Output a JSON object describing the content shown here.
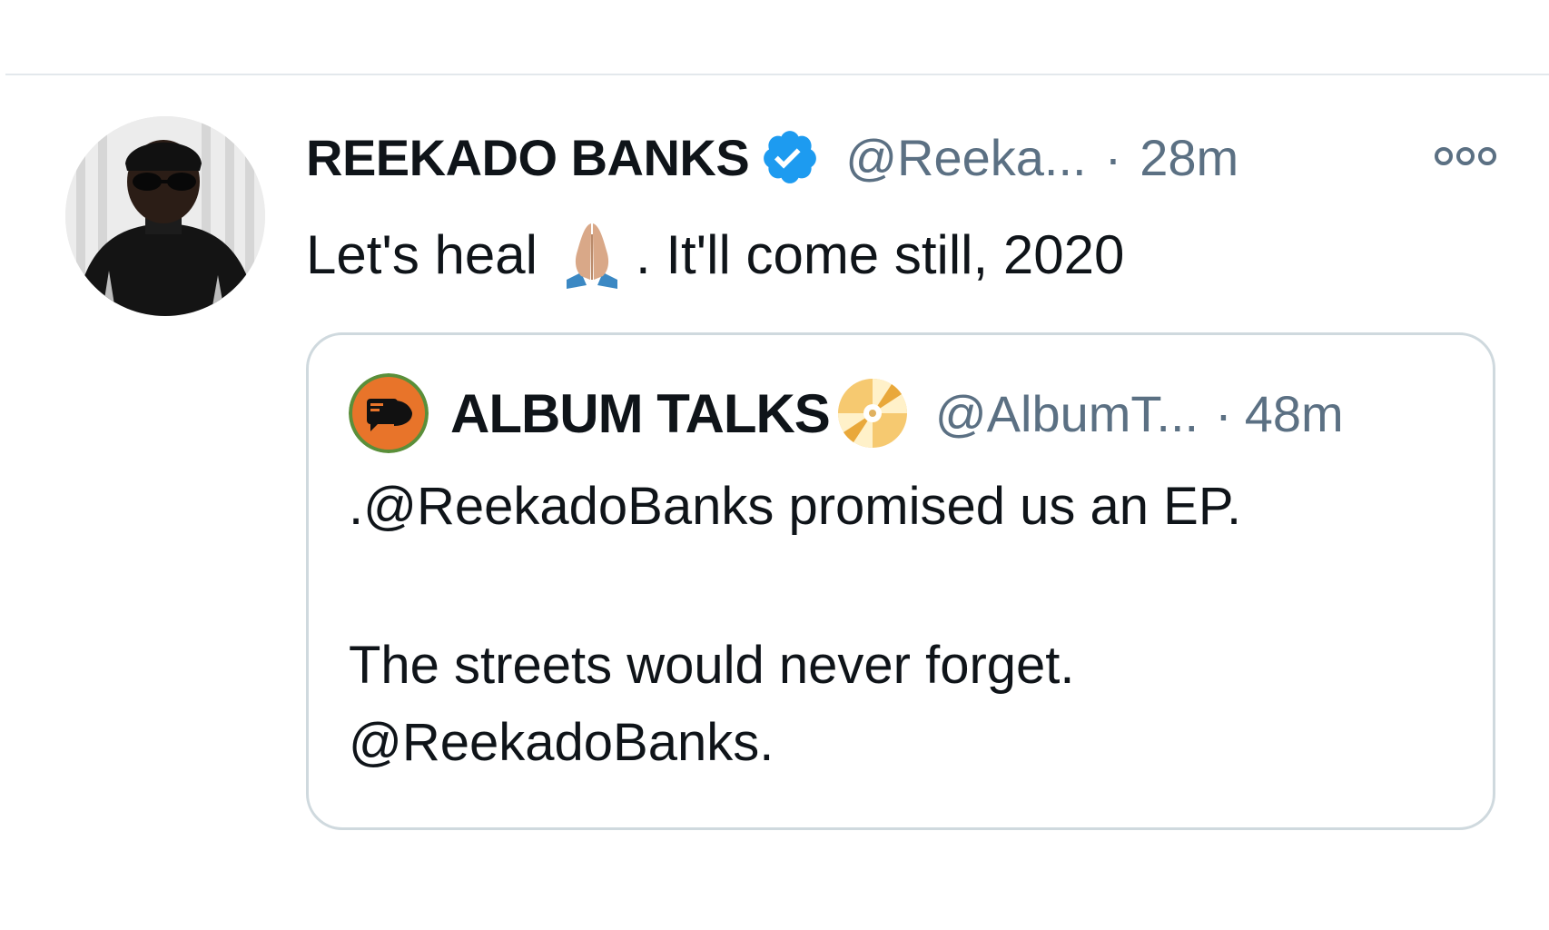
{
  "tweet": {
    "author": {
      "display_name": "REEKADO BANKS",
      "handle": "@Reeka...",
      "verified": true,
      "avatar": "profile-photo-man-sunglasses"
    },
    "separator": "·",
    "time": "28m",
    "more_icon": "more-horizontal-icon",
    "text_before_emoji": "Let's heal",
    "emoji": "folded-hands",
    "text_after_emoji": ". It'll come still, 2020"
  },
  "quoted_tweet": {
    "author": {
      "display_name": "ALBUM TALKS",
      "name_emoji": "dvd-disc",
      "handle": "@AlbumT...",
      "avatar": "album-talks-logo"
    },
    "separator": "·",
    "time": "48m",
    "lines": [
      ".@ReekadoBanks promised us an EP.",
      "The streets would never forget.",
      "@ReekadoBanks."
    ]
  },
  "colors": {
    "text_primary": "#0f1419",
    "text_secondary": "#5b7083",
    "verified_blue": "#1d9bf0",
    "border": "#cfd9de"
  }
}
